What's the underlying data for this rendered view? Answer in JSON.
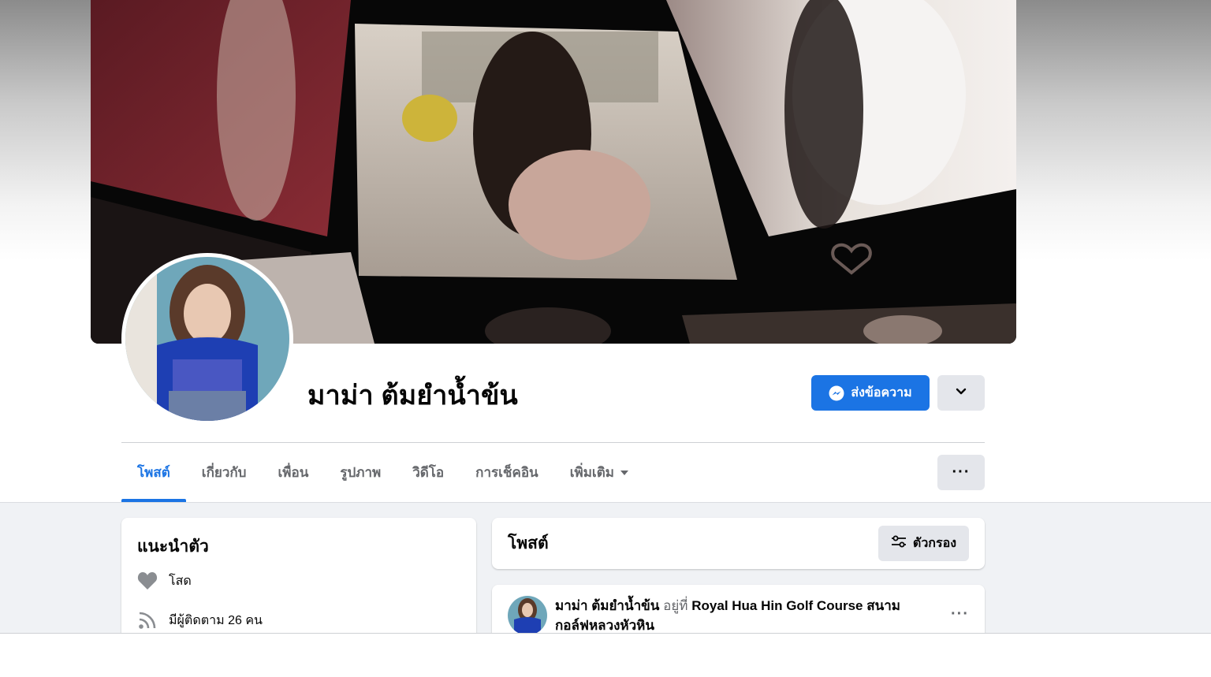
{
  "profile": {
    "name": "มาม่า ต้มยำน้ำข้น",
    "message_button_label": "ส่งข้อความ",
    "cover_icon": "cover-photo-collage",
    "avatar_icon": "profile-photo"
  },
  "tabs": [
    {
      "label": "โพสต์",
      "active": true
    },
    {
      "label": "เกี่ยวกับ",
      "active": false
    },
    {
      "label": "เพื่อน",
      "active": false
    },
    {
      "label": "รูปภาพ",
      "active": false
    },
    {
      "label": "วิดีโอ",
      "active": false
    },
    {
      "label": "การเช็คอิน",
      "active": false
    },
    {
      "label": "เพิ่มเติม",
      "active": false
    }
  ],
  "tab_more_dots": "···",
  "intro": {
    "title": "แนะนำตัว",
    "relationship": "โสด",
    "followers": "มีผู้ติดตาม 26 คน"
  },
  "posts": {
    "title": "โพสต์",
    "filter_label": "ตัวกรอง"
  },
  "post": {
    "author": "มาม่า ต้มยำน้ำข้น",
    "at_text": "อยู่ที่",
    "place": "Royal Hua Hin Golf Course สนามกอล์ฟหลวงหัวหิน",
    "more": "···"
  },
  "colors": {
    "accent": "#1b74e4",
    "secondary_text": "#65676b",
    "button_grey": "#e4e6eb",
    "feed_bg": "#f0f2f5"
  }
}
